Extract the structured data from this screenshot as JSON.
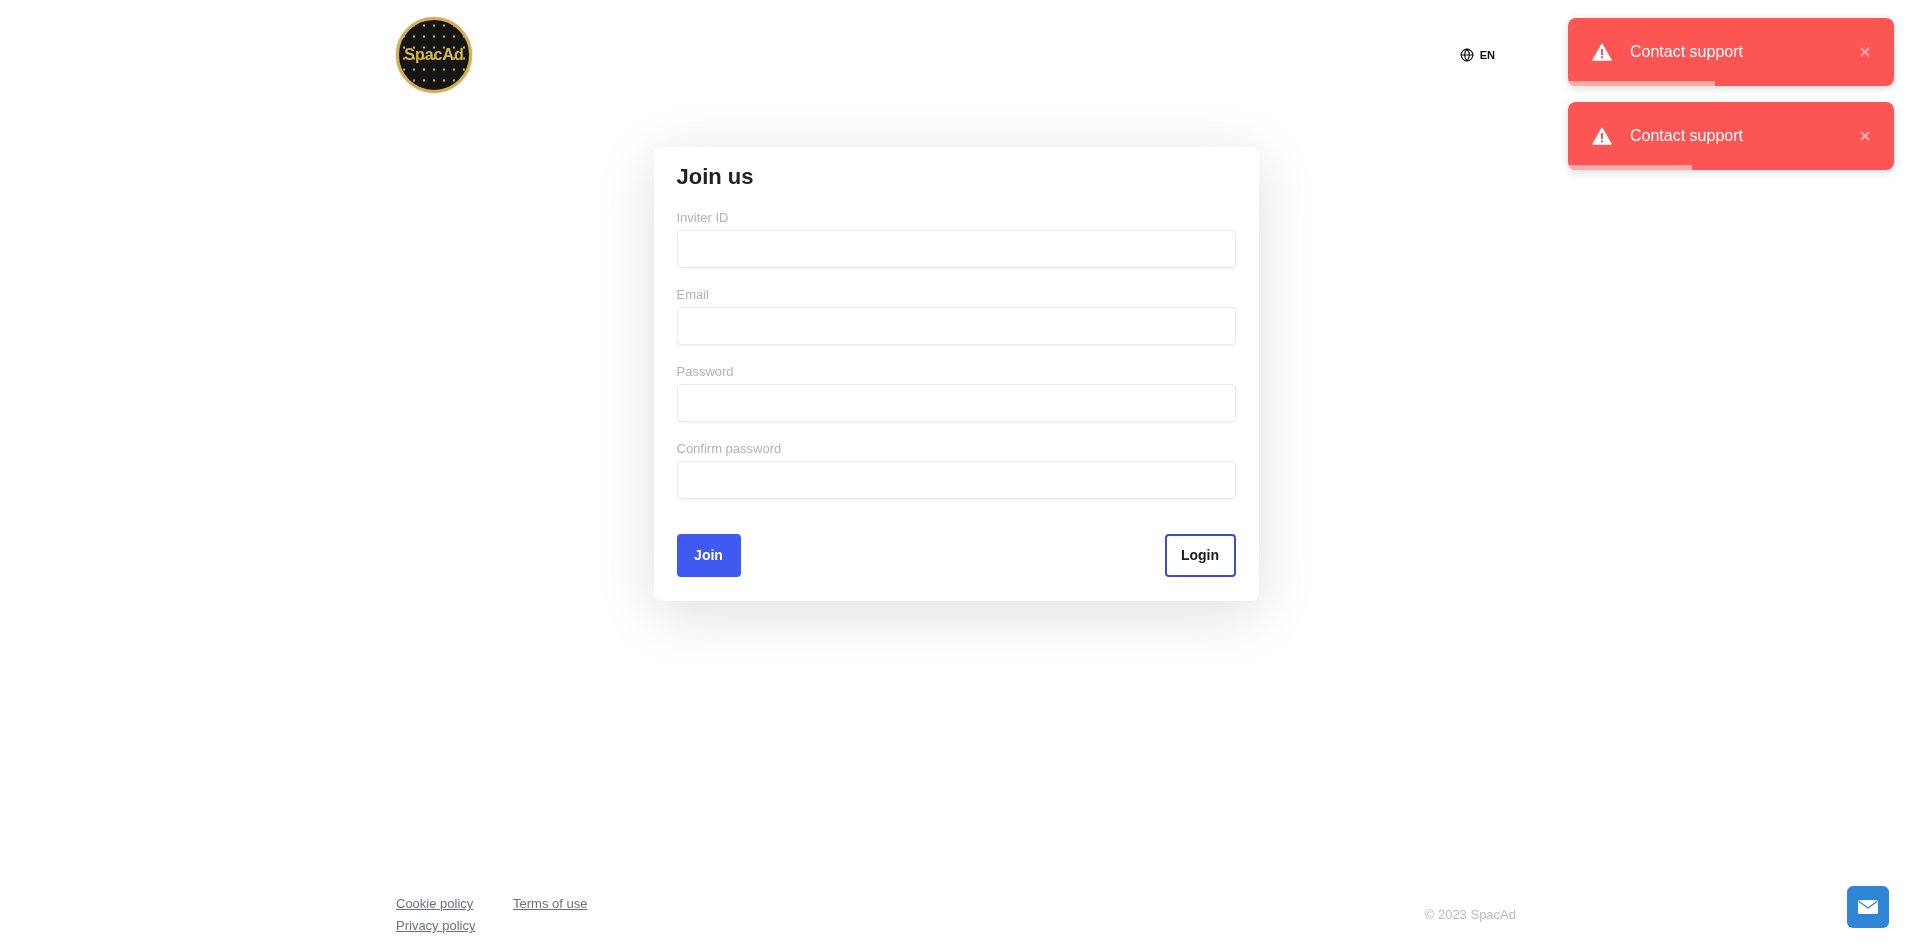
{
  "header": {
    "logo_text": "SpacAd",
    "language": "EN"
  },
  "toasts": [
    {
      "message": "Contact support",
      "level": 0.45
    },
    {
      "message": "Contact support",
      "level": 0.38
    }
  ],
  "form": {
    "title": "Join us",
    "fields": [
      {
        "label": "Inviter ID"
      },
      {
        "label": "Email"
      },
      {
        "label": "Password"
      },
      {
        "label": "Confirm password"
      }
    ],
    "buttons": [
      {
        "label": "Join",
        "kind": "primary"
      },
      {
        "label": "Login",
        "kind": "outline"
      }
    ]
  },
  "footer": {
    "links": [
      "Cookie policy",
      "Terms of use",
      "Privacy policy"
    ],
    "copyright": "© 2023 SpacAd"
  }
}
